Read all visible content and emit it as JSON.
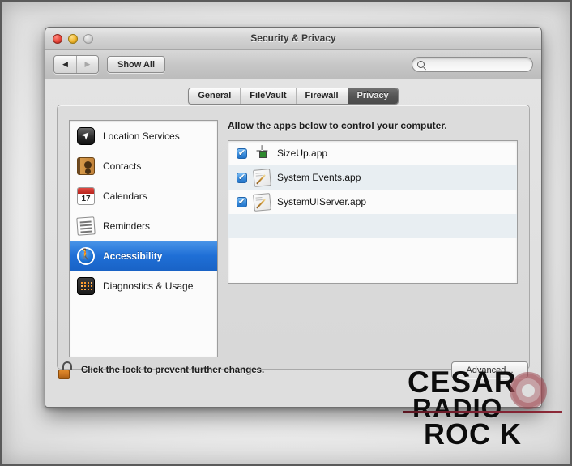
{
  "window": {
    "title": "Security & Privacy",
    "traffic_lights": [
      "close-button",
      "minimize-button",
      "zoom-button"
    ]
  },
  "toolbar": {
    "back_label": "◀",
    "forward_label": "▶",
    "show_all_label": "Show All",
    "search": {
      "value": "",
      "placeholder": "",
      "icon": "search-icon"
    }
  },
  "tabs": [
    {
      "label": "General",
      "active": false
    },
    {
      "label": "FileVault",
      "active": false
    },
    {
      "label": "Firewall",
      "active": false
    },
    {
      "label": "Privacy",
      "active": true
    }
  ],
  "sidebar": {
    "items": [
      {
        "label": "Location Services",
        "icon": "location-services-icon",
        "selected": false
      },
      {
        "label": "Contacts",
        "icon": "contacts-icon",
        "selected": false
      },
      {
        "label": "Calendars",
        "icon": "calendar-icon",
        "calendar_day": "17",
        "selected": false
      },
      {
        "label": "Reminders",
        "icon": "reminders-icon",
        "selected": false
      },
      {
        "label": "Accessibility",
        "icon": "accessibility-icon",
        "selected": true
      },
      {
        "label": "Diagnostics & Usage",
        "icon": "diagnostics-icon",
        "selected": false
      }
    ]
  },
  "main": {
    "allow_label": "Allow the apps below to control your computer.",
    "apps": [
      {
        "name": "SizeUp.app",
        "checked": true,
        "icon": "sizeup-icon"
      },
      {
        "name": "System Events.app",
        "checked": true,
        "icon": "script-editor-icon"
      },
      {
        "name": "SystemUIServer.app",
        "checked": true,
        "icon": "script-editor-icon"
      }
    ]
  },
  "bottom": {
    "lock_icon": "unlocked-padlock-icon",
    "lock_text": "Click the lock to prevent further changes.",
    "advanced_label": "Advanced..."
  },
  "watermark": {
    "line1": "CESAR",
    "line2": "RADIO",
    "line3": "ROC K"
  },
  "colors": {
    "selection_blue": "#1f6fd6",
    "checkbox_blue": "#3a8ddd",
    "lock_orange": "#c97420",
    "active_tab_dark": "#555555",
    "watermark_line_red": "#7c2030"
  }
}
